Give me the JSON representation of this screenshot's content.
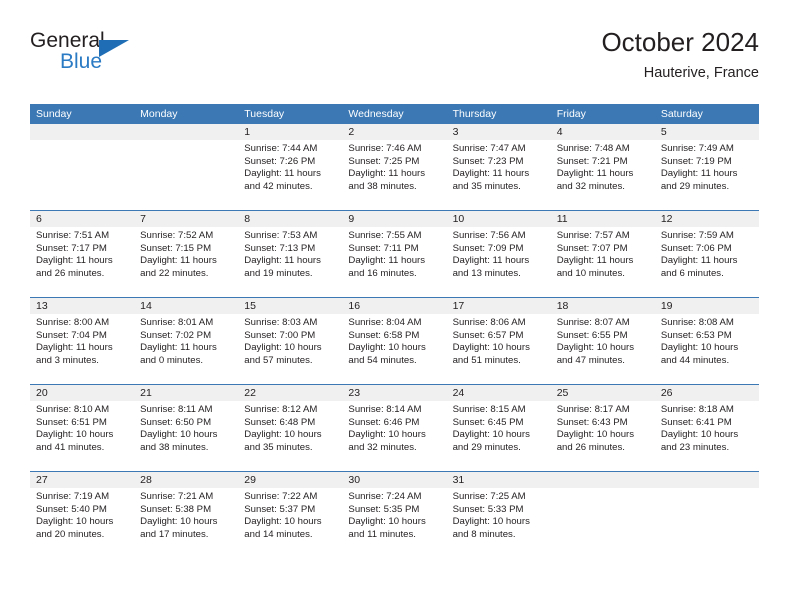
{
  "brand": {
    "word_one": "General",
    "word_two": "Blue",
    "logo_icon": "triangle-logo-icon",
    "accent_color": "#1f6eb5",
    "blue_text_color": "#2a7ac4"
  },
  "header": {
    "title": "October 2024",
    "subtitle": "Hauterive, France"
  },
  "calendar": {
    "header_bg": "#3b78b4",
    "daynum_bg": "#f0f0f0",
    "weekdays": [
      "Sunday",
      "Monday",
      "Tuesday",
      "Wednesday",
      "Thursday",
      "Friday",
      "Saturday"
    ],
    "weeks": [
      [
        {
          "day": "",
          "sunrise": "",
          "sunset": "",
          "daylight_line1": "",
          "daylight_line2": ""
        },
        {
          "day": "",
          "sunrise": "",
          "sunset": "",
          "daylight_line1": "",
          "daylight_line2": ""
        },
        {
          "day": "1",
          "sunrise": "Sunrise: 7:44 AM",
          "sunset": "Sunset: 7:26 PM",
          "daylight_line1": "Daylight: 11 hours",
          "daylight_line2": "and 42 minutes."
        },
        {
          "day": "2",
          "sunrise": "Sunrise: 7:46 AM",
          "sunset": "Sunset: 7:25 PM",
          "daylight_line1": "Daylight: 11 hours",
          "daylight_line2": "and 38 minutes."
        },
        {
          "day": "3",
          "sunrise": "Sunrise: 7:47 AM",
          "sunset": "Sunset: 7:23 PM",
          "daylight_line1": "Daylight: 11 hours",
          "daylight_line2": "and 35 minutes."
        },
        {
          "day": "4",
          "sunrise": "Sunrise: 7:48 AM",
          "sunset": "Sunset: 7:21 PM",
          "daylight_line1": "Daylight: 11 hours",
          "daylight_line2": "and 32 minutes."
        },
        {
          "day": "5",
          "sunrise": "Sunrise: 7:49 AM",
          "sunset": "Sunset: 7:19 PM",
          "daylight_line1": "Daylight: 11 hours",
          "daylight_line2": "and 29 minutes."
        }
      ],
      [
        {
          "day": "6",
          "sunrise": "Sunrise: 7:51 AM",
          "sunset": "Sunset: 7:17 PM",
          "daylight_line1": "Daylight: 11 hours",
          "daylight_line2": "and 26 minutes."
        },
        {
          "day": "7",
          "sunrise": "Sunrise: 7:52 AM",
          "sunset": "Sunset: 7:15 PM",
          "daylight_line1": "Daylight: 11 hours",
          "daylight_line2": "and 22 minutes."
        },
        {
          "day": "8",
          "sunrise": "Sunrise: 7:53 AM",
          "sunset": "Sunset: 7:13 PM",
          "daylight_line1": "Daylight: 11 hours",
          "daylight_line2": "and 19 minutes."
        },
        {
          "day": "9",
          "sunrise": "Sunrise: 7:55 AM",
          "sunset": "Sunset: 7:11 PM",
          "daylight_line1": "Daylight: 11 hours",
          "daylight_line2": "and 16 minutes."
        },
        {
          "day": "10",
          "sunrise": "Sunrise: 7:56 AM",
          "sunset": "Sunset: 7:09 PM",
          "daylight_line1": "Daylight: 11 hours",
          "daylight_line2": "and 13 minutes."
        },
        {
          "day": "11",
          "sunrise": "Sunrise: 7:57 AM",
          "sunset": "Sunset: 7:07 PM",
          "daylight_line1": "Daylight: 11 hours",
          "daylight_line2": "and 10 minutes."
        },
        {
          "day": "12",
          "sunrise": "Sunrise: 7:59 AM",
          "sunset": "Sunset: 7:06 PM",
          "daylight_line1": "Daylight: 11 hours",
          "daylight_line2": "and 6 minutes."
        }
      ],
      [
        {
          "day": "13",
          "sunrise": "Sunrise: 8:00 AM",
          "sunset": "Sunset: 7:04 PM",
          "daylight_line1": "Daylight: 11 hours",
          "daylight_line2": "and 3 minutes."
        },
        {
          "day": "14",
          "sunrise": "Sunrise: 8:01 AM",
          "sunset": "Sunset: 7:02 PM",
          "daylight_line1": "Daylight: 11 hours",
          "daylight_line2": "and 0 minutes."
        },
        {
          "day": "15",
          "sunrise": "Sunrise: 8:03 AM",
          "sunset": "Sunset: 7:00 PM",
          "daylight_line1": "Daylight: 10 hours",
          "daylight_line2": "and 57 minutes."
        },
        {
          "day": "16",
          "sunrise": "Sunrise: 8:04 AM",
          "sunset": "Sunset: 6:58 PM",
          "daylight_line1": "Daylight: 10 hours",
          "daylight_line2": "and 54 minutes."
        },
        {
          "day": "17",
          "sunrise": "Sunrise: 8:06 AM",
          "sunset": "Sunset: 6:57 PM",
          "daylight_line1": "Daylight: 10 hours",
          "daylight_line2": "and 51 minutes."
        },
        {
          "day": "18",
          "sunrise": "Sunrise: 8:07 AM",
          "sunset": "Sunset: 6:55 PM",
          "daylight_line1": "Daylight: 10 hours",
          "daylight_line2": "and 47 minutes."
        },
        {
          "day": "19",
          "sunrise": "Sunrise: 8:08 AM",
          "sunset": "Sunset: 6:53 PM",
          "daylight_line1": "Daylight: 10 hours",
          "daylight_line2": "and 44 minutes."
        }
      ],
      [
        {
          "day": "20",
          "sunrise": "Sunrise: 8:10 AM",
          "sunset": "Sunset: 6:51 PM",
          "daylight_line1": "Daylight: 10 hours",
          "daylight_line2": "and 41 minutes."
        },
        {
          "day": "21",
          "sunrise": "Sunrise: 8:11 AM",
          "sunset": "Sunset: 6:50 PM",
          "daylight_line1": "Daylight: 10 hours",
          "daylight_line2": "and 38 minutes."
        },
        {
          "day": "22",
          "sunrise": "Sunrise: 8:12 AM",
          "sunset": "Sunset: 6:48 PM",
          "daylight_line1": "Daylight: 10 hours",
          "daylight_line2": "and 35 minutes."
        },
        {
          "day": "23",
          "sunrise": "Sunrise: 8:14 AM",
          "sunset": "Sunset: 6:46 PM",
          "daylight_line1": "Daylight: 10 hours",
          "daylight_line2": "and 32 minutes."
        },
        {
          "day": "24",
          "sunrise": "Sunrise: 8:15 AM",
          "sunset": "Sunset: 6:45 PM",
          "daylight_line1": "Daylight: 10 hours",
          "daylight_line2": "and 29 minutes."
        },
        {
          "day": "25",
          "sunrise": "Sunrise: 8:17 AM",
          "sunset": "Sunset: 6:43 PM",
          "daylight_line1": "Daylight: 10 hours",
          "daylight_line2": "and 26 minutes."
        },
        {
          "day": "26",
          "sunrise": "Sunrise: 8:18 AM",
          "sunset": "Sunset: 6:41 PM",
          "daylight_line1": "Daylight: 10 hours",
          "daylight_line2": "and 23 minutes."
        }
      ],
      [
        {
          "day": "27",
          "sunrise": "Sunrise: 7:19 AM",
          "sunset": "Sunset: 5:40 PM",
          "daylight_line1": "Daylight: 10 hours",
          "daylight_line2": "and 20 minutes."
        },
        {
          "day": "28",
          "sunrise": "Sunrise: 7:21 AM",
          "sunset": "Sunset: 5:38 PM",
          "daylight_line1": "Daylight: 10 hours",
          "daylight_line2": "and 17 minutes."
        },
        {
          "day": "29",
          "sunrise": "Sunrise: 7:22 AM",
          "sunset": "Sunset: 5:37 PM",
          "daylight_line1": "Daylight: 10 hours",
          "daylight_line2": "and 14 minutes."
        },
        {
          "day": "30",
          "sunrise": "Sunrise: 7:24 AM",
          "sunset": "Sunset: 5:35 PM",
          "daylight_line1": "Daylight: 10 hours",
          "daylight_line2": "and 11 minutes."
        },
        {
          "day": "31",
          "sunrise": "Sunrise: 7:25 AM",
          "sunset": "Sunset: 5:33 PM",
          "daylight_line1": "Daylight: 10 hours",
          "daylight_line2": "and 8 minutes."
        },
        {
          "day": "",
          "sunrise": "",
          "sunset": "",
          "daylight_line1": "",
          "daylight_line2": ""
        },
        {
          "day": "",
          "sunrise": "",
          "sunset": "",
          "daylight_line1": "",
          "daylight_line2": ""
        }
      ]
    ]
  }
}
